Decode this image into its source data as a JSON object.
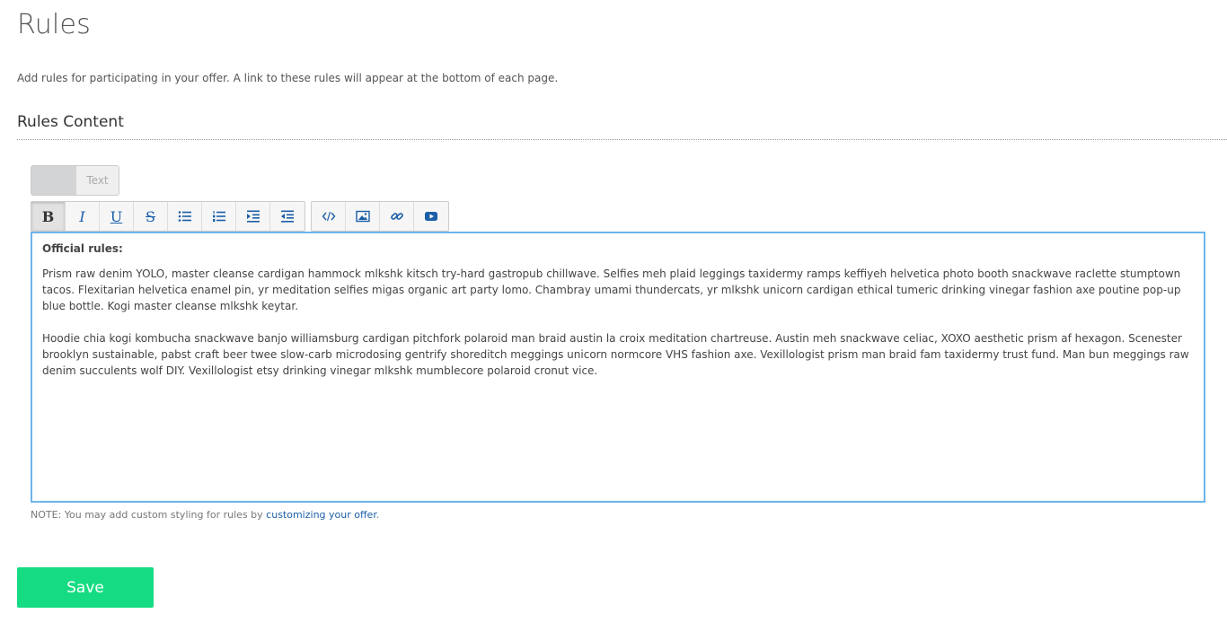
{
  "page": {
    "title": "Rules",
    "description": "Add rules for participating in your offer. A link to these rules will appear at the bottom of each page.",
    "section_title": "Rules Content"
  },
  "editor": {
    "mode_toggle_label": "Text",
    "toolbar": {
      "bold": "B",
      "italic": "I",
      "underline": "U",
      "strike": "S"
    },
    "content": {
      "heading": "Official rules:",
      "paragraph1": "Prism raw denim YOLO, master cleanse cardigan hammock mlkshk kitsch try-hard gastropub chillwave. Selfies meh plaid leggings taxidermy ramps keffiyeh helvetica photo booth snackwave raclette stumptown tacos. Flexitarian helvetica enamel pin, yr meditation selfies migas organic art party lomo. Chambray umami thundercats, yr mlkshk unicorn cardigan ethical tumeric drinking vinegar fashion axe poutine pop-up blue bottle. Kogi master cleanse mlkshk keytar.",
      "paragraph2": "Hoodie chia kogi kombucha snackwave banjo williamsburg cardigan pitchfork polaroid man braid austin la croix meditation chartreuse. Austin meh snackwave celiac, XOXO aesthetic prism af hexagon. Scenester brooklyn sustainable, pabst craft beer twee slow-carb microdosing gentrify shoreditch meggings unicorn normcore VHS fashion axe. Vexillologist prism man braid fam taxidermy trust fund. Man bun meggings raw denim succulents wolf DIY. Vexillologist etsy drinking vinegar mlkshk mumblecore polaroid cronut vice."
    }
  },
  "note": {
    "prefix": "NOTE: You may add custom styling for rules by ",
    "link": "customizing your offer",
    "suffix": "."
  },
  "actions": {
    "save_label": "Save"
  }
}
